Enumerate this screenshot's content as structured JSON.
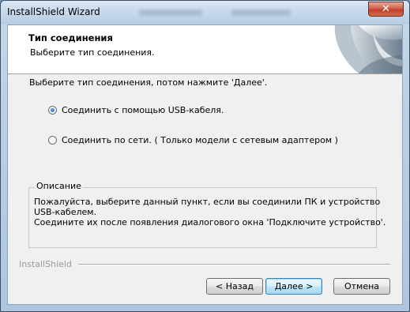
{
  "window": {
    "title": "InstallShield Wizard",
    "close_glyph": "✕"
  },
  "header": {
    "title": "Тип соединения",
    "subtitle": "Выберите тип соединения."
  },
  "instruction": "Выберите тип соединения, потом нажмите 'Далее'.",
  "options": [
    {
      "label": "Соединить с помощью USB-кабеля.",
      "selected": true
    },
    {
      "label": "Соединить по сети. ( Только модели с сетевым адаптером )",
      "selected": false
    }
  ],
  "description": {
    "label": "Описание",
    "lines": [
      "Пожалуйста, выберите данный пункт, если вы соединили ПК и устройство",
      "USB-кабелем.",
      "Соедините их после появления диалогового окна 'Подключите устройство'."
    ]
  },
  "branding": "InstallShield",
  "buttons": {
    "back": "< Назад",
    "next": "Далее >",
    "cancel": "Отмена"
  },
  "icons": {
    "close": "close-icon",
    "header_art": "page-curl-graphic",
    "radio": "radio-button"
  },
  "colors": {
    "window_frame": "#b9cfe5",
    "close_button": "#c2402a",
    "dialog_bg": "#f0f0f0",
    "default_button": "#bee6fd"
  }
}
